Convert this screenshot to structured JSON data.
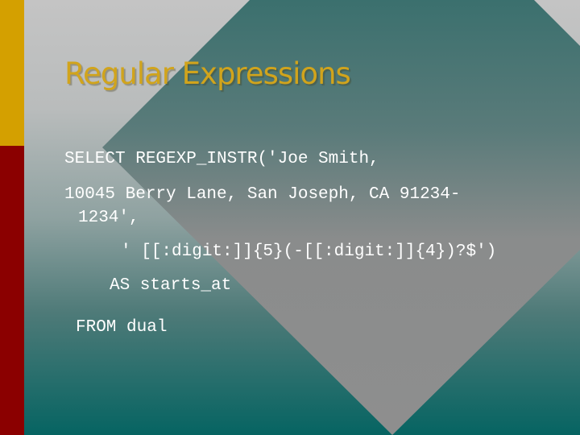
{
  "slide": {
    "title": "Regular Expressions",
    "code_lines": [
      "SELECT REGEXP_INSTR('Joe Smith,",
      "10045 Berry Lane, San Joseph, CA 91234-",
      "1234',",
      "' [[:digit:]]{5}(-[[:digit:]]{4})?$')",
      "AS starts_at",
      "FROM dual"
    ]
  },
  "colors": {
    "title": "#d1a41c",
    "accent_bar_top": "#d4a000",
    "accent_bar_bottom": "#8b0000",
    "teal": "#066462",
    "gray": "#c4c4c4",
    "code_text": "#ffffff"
  }
}
